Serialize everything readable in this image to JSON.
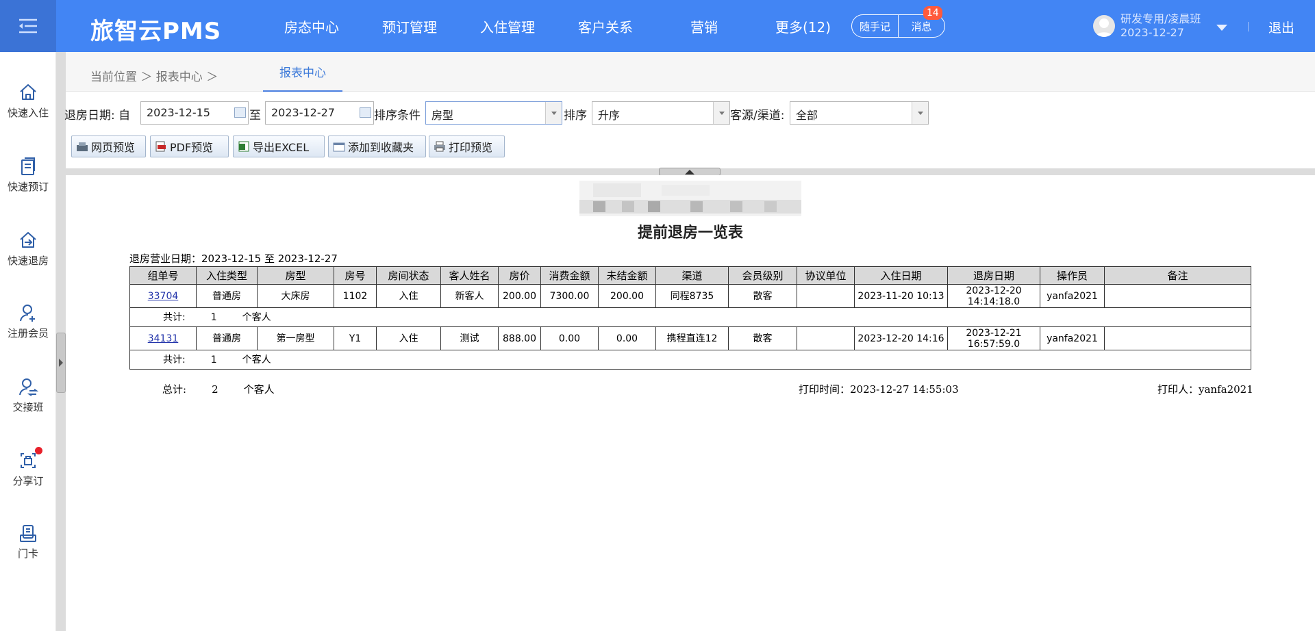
{
  "app": {
    "brand": "旅智云PMS"
  },
  "nav": [
    "房态中心",
    "预订管理",
    "入住管理",
    "客户关系",
    "营销",
    "更多(12)"
  ],
  "quick": {
    "notes": "随手记",
    "messages": "消息",
    "badge": "14"
  },
  "user": {
    "name": "研发专用/凌晨班",
    "date": "2023-12-27",
    "logout": "退出"
  },
  "sidebar": [
    {
      "label": "快速入住",
      "icon": "home-icon"
    },
    {
      "label": "快速预订",
      "icon": "booking-icon"
    },
    {
      "label": "快速退房",
      "icon": "checkout-icon"
    },
    {
      "label": "注册会员",
      "icon": "add-member-icon"
    },
    {
      "label": "交接班",
      "icon": "shift-icon"
    },
    {
      "label": "分享订",
      "icon": "share-icon"
    },
    {
      "label": "门卡",
      "icon": "card-icon"
    }
  ],
  "breadcrumb": {
    "label": "当前位置 ＞ 报表中心 ＞",
    "tab": "报表中心"
  },
  "filters": {
    "date_label": "退房日期: 自",
    "date_from": "2023-12-15",
    "to_label": "至",
    "date_to": "2023-12-27",
    "sort_field_label": "排序条件",
    "sort_field": "房型",
    "sort_label": "排序",
    "sort_order": "升序",
    "channel_label": "客源/渠道:",
    "channel": "全部"
  },
  "buttons": [
    "网页预览",
    "PDF预览",
    "导出EXCEL",
    "添加到收藏夹",
    "打印预览"
  ],
  "report": {
    "title": "提前退房一览表",
    "period": "退房营业日期：2023-12-15 至 2023-12-27",
    "columns": [
      "组单号",
      "入住类型",
      "房型",
      "房号",
      "房间状态",
      "客人姓名",
      "房价",
      "消费金额",
      "未结金额",
      "渠道",
      "会员级别",
      "协议单位",
      "入住日期",
      "退房日期",
      "操作员",
      "备注"
    ],
    "rows": [
      [
        "33704",
        "普通房",
        "大床房",
        "1102",
        "入住",
        "新客人",
        "200.00",
        "7300.00",
        "200.00",
        "同程8735",
        "散客",
        "",
        "2023-11-20 10:13",
        "2023-12-20 14:14:18.0",
        "yanfa2021",
        ""
      ],
      [
        "34131",
        "普通房",
        "第一房型",
        "Y1",
        "入住",
        "测试",
        "888.00",
        "0.00",
        "0.00",
        "携程直连12",
        "散客",
        "",
        "2023-12-20 14:16",
        "2023-12-21 16:57:59.0",
        "yanfa2021",
        ""
      ]
    ],
    "subtotal_label": "共计:",
    "subtotals": [
      "1",
      "1"
    ],
    "unit": "个客人",
    "total_label": "总计:",
    "total": "2",
    "print_time": "打印时间：2023-12-27 14:55:03",
    "printer": "打印人：yanfa2021"
  }
}
